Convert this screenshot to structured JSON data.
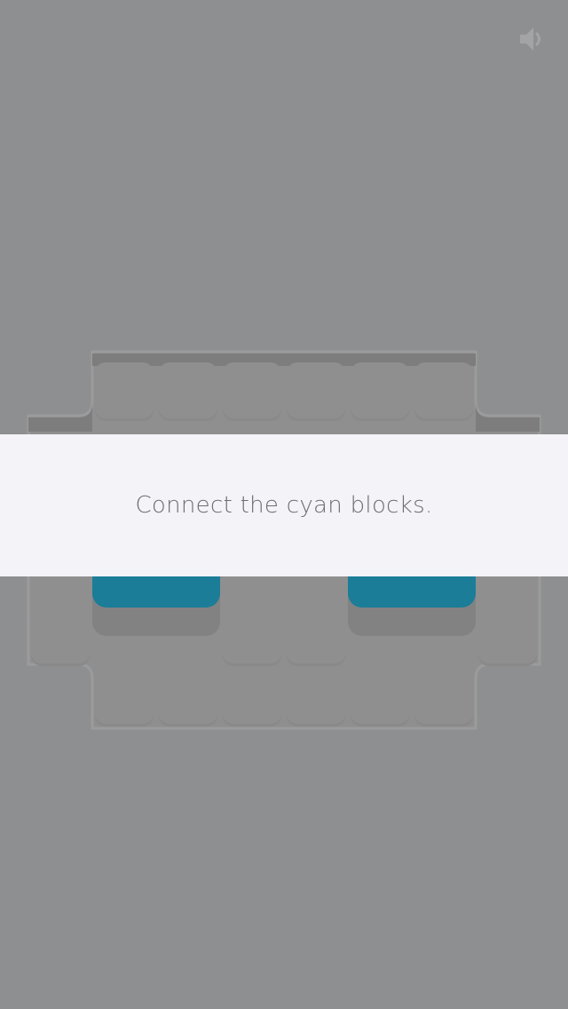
{
  "banner": {
    "message": "Connect the cyan blocks."
  },
  "sound_button": {
    "icon": "speaker-icon",
    "state": "on"
  },
  "board": {
    "block_color": "#1b7d98",
    "board_color": "#8f8f90",
    "background_color": "#8e8f90"
  }
}
